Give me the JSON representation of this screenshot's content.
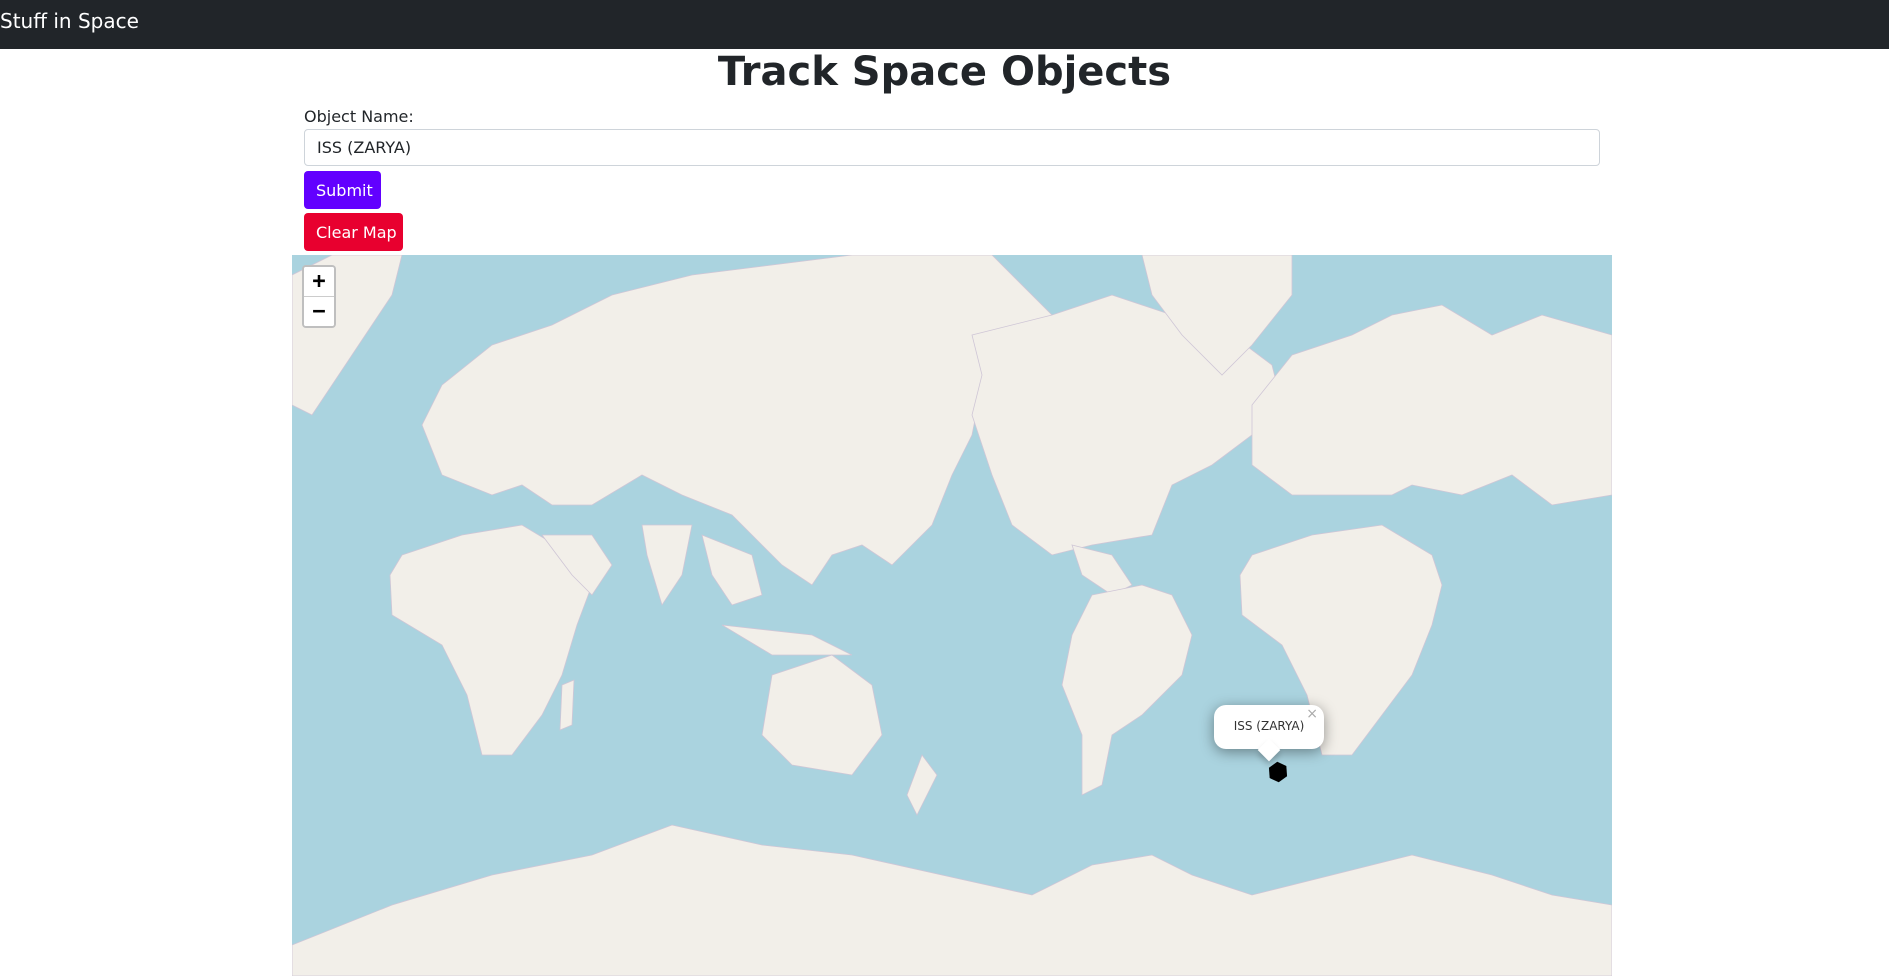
{
  "navbar": {
    "brand": "Stuff in Space"
  },
  "page": {
    "title": "Track Space Objects"
  },
  "form": {
    "object_label": "Object Name:",
    "object_value": "ISS (ZARYA)",
    "submit_label": "Submit",
    "clear_label": "Clear Map"
  },
  "map": {
    "zoom_in_label": "+",
    "zoom_out_label": "−",
    "popup_text": "ISS (ZARYA)",
    "popup_close": "×",
    "marker_icon": "satellite-hexagon-icon",
    "colors": {
      "ocean": "#aad3df",
      "land": "#f2efe9",
      "border": "#b6a7c3"
    }
  },
  "colors": {
    "navbar": "#212529",
    "submit": "#6200ff",
    "clear": "#e8002f"
  }
}
